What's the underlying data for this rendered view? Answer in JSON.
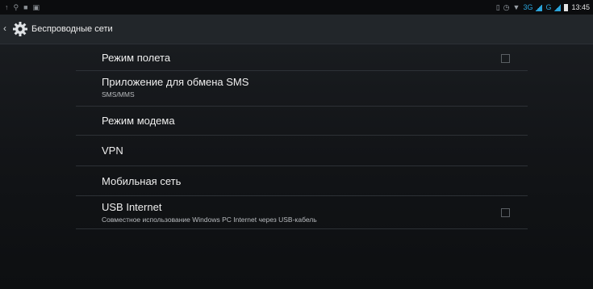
{
  "status_bar": {
    "network": "3G",
    "network2": "G",
    "time": "13:45"
  },
  "action_bar": {
    "title": "Беспроводные сети"
  },
  "settings": [
    {
      "title": "Режим полета",
      "checkbox": true,
      "checked": false
    },
    {
      "title": "Приложение для обмена SMS",
      "summary": "SMS/MMS"
    },
    {
      "title": "Режим модема"
    },
    {
      "title": "VPN"
    },
    {
      "title": "Мобильная сеть"
    },
    {
      "title": "USB Internet",
      "summary": "Совместное использование Windows PC Internet через USB-кабель",
      "checkbox": true,
      "checked": false
    }
  ],
  "colors": {
    "background": "#121417",
    "accent": "#2aa3d9",
    "divider": "#2d3136"
  }
}
